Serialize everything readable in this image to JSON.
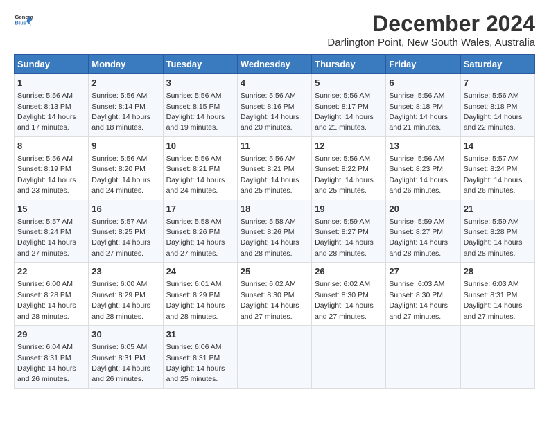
{
  "logo": {
    "line1": "General",
    "line2": "Blue"
  },
  "title": "December 2024",
  "subtitle": "Darlington Point, New South Wales, Australia",
  "days_of_week": [
    "Sunday",
    "Monday",
    "Tuesday",
    "Wednesday",
    "Thursday",
    "Friday",
    "Saturday"
  ],
  "weeks": [
    [
      {
        "day": "1",
        "sunrise": "Sunrise: 5:56 AM",
        "sunset": "Sunset: 8:13 PM",
        "daylight": "Daylight: 14 hours and 17 minutes."
      },
      {
        "day": "2",
        "sunrise": "Sunrise: 5:56 AM",
        "sunset": "Sunset: 8:14 PM",
        "daylight": "Daylight: 14 hours and 18 minutes."
      },
      {
        "day": "3",
        "sunrise": "Sunrise: 5:56 AM",
        "sunset": "Sunset: 8:15 PM",
        "daylight": "Daylight: 14 hours and 19 minutes."
      },
      {
        "day": "4",
        "sunrise": "Sunrise: 5:56 AM",
        "sunset": "Sunset: 8:16 PM",
        "daylight": "Daylight: 14 hours and 20 minutes."
      },
      {
        "day": "5",
        "sunrise": "Sunrise: 5:56 AM",
        "sunset": "Sunset: 8:17 PM",
        "daylight": "Daylight: 14 hours and 21 minutes."
      },
      {
        "day": "6",
        "sunrise": "Sunrise: 5:56 AM",
        "sunset": "Sunset: 8:18 PM",
        "daylight": "Daylight: 14 hours and 21 minutes."
      },
      {
        "day": "7",
        "sunrise": "Sunrise: 5:56 AM",
        "sunset": "Sunset: 8:18 PM",
        "daylight": "Daylight: 14 hours and 22 minutes."
      }
    ],
    [
      {
        "day": "8",
        "sunrise": "Sunrise: 5:56 AM",
        "sunset": "Sunset: 8:19 PM",
        "daylight": "Daylight: 14 hours and 23 minutes."
      },
      {
        "day": "9",
        "sunrise": "Sunrise: 5:56 AM",
        "sunset": "Sunset: 8:20 PM",
        "daylight": "Daylight: 14 hours and 24 minutes."
      },
      {
        "day": "10",
        "sunrise": "Sunrise: 5:56 AM",
        "sunset": "Sunset: 8:21 PM",
        "daylight": "Daylight: 14 hours and 24 minutes."
      },
      {
        "day": "11",
        "sunrise": "Sunrise: 5:56 AM",
        "sunset": "Sunset: 8:21 PM",
        "daylight": "Daylight: 14 hours and 25 minutes."
      },
      {
        "day": "12",
        "sunrise": "Sunrise: 5:56 AM",
        "sunset": "Sunset: 8:22 PM",
        "daylight": "Daylight: 14 hours and 25 minutes."
      },
      {
        "day": "13",
        "sunrise": "Sunrise: 5:56 AM",
        "sunset": "Sunset: 8:23 PM",
        "daylight": "Daylight: 14 hours and 26 minutes."
      },
      {
        "day": "14",
        "sunrise": "Sunrise: 5:57 AM",
        "sunset": "Sunset: 8:24 PM",
        "daylight": "Daylight: 14 hours and 26 minutes."
      }
    ],
    [
      {
        "day": "15",
        "sunrise": "Sunrise: 5:57 AM",
        "sunset": "Sunset: 8:24 PM",
        "daylight": "Daylight: 14 hours and 27 minutes."
      },
      {
        "day": "16",
        "sunrise": "Sunrise: 5:57 AM",
        "sunset": "Sunset: 8:25 PM",
        "daylight": "Daylight: 14 hours and 27 minutes."
      },
      {
        "day": "17",
        "sunrise": "Sunrise: 5:58 AM",
        "sunset": "Sunset: 8:26 PM",
        "daylight": "Daylight: 14 hours and 27 minutes."
      },
      {
        "day": "18",
        "sunrise": "Sunrise: 5:58 AM",
        "sunset": "Sunset: 8:26 PM",
        "daylight": "Daylight: 14 hours and 28 minutes."
      },
      {
        "day": "19",
        "sunrise": "Sunrise: 5:59 AM",
        "sunset": "Sunset: 8:27 PM",
        "daylight": "Daylight: 14 hours and 28 minutes."
      },
      {
        "day": "20",
        "sunrise": "Sunrise: 5:59 AM",
        "sunset": "Sunset: 8:27 PM",
        "daylight": "Daylight: 14 hours and 28 minutes."
      },
      {
        "day": "21",
        "sunrise": "Sunrise: 5:59 AM",
        "sunset": "Sunset: 8:28 PM",
        "daylight": "Daylight: 14 hours and 28 minutes."
      }
    ],
    [
      {
        "day": "22",
        "sunrise": "Sunrise: 6:00 AM",
        "sunset": "Sunset: 8:28 PM",
        "daylight": "Daylight: 14 hours and 28 minutes."
      },
      {
        "day": "23",
        "sunrise": "Sunrise: 6:00 AM",
        "sunset": "Sunset: 8:29 PM",
        "daylight": "Daylight: 14 hours and 28 minutes."
      },
      {
        "day": "24",
        "sunrise": "Sunrise: 6:01 AM",
        "sunset": "Sunset: 8:29 PM",
        "daylight": "Daylight: 14 hours and 28 minutes."
      },
      {
        "day": "25",
        "sunrise": "Sunrise: 6:02 AM",
        "sunset": "Sunset: 8:30 PM",
        "daylight": "Daylight: 14 hours and 27 minutes."
      },
      {
        "day": "26",
        "sunrise": "Sunrise: 6:02 AM",
        "sunset": "Sunset: 8:30 PM",
        "daylight": "Daylight: 14 hours and 27 minutes."
      },
      {
        "day": "27",
        "sunrise": "Sunrise: 6:03 AM",
        "sunset": "Sunset: 8:30 PM",
        "daylight": "Daylight: 14 hours and 27 minutes."
      },
      {
        "day": "28",
        "sunrise": "Sunrise: 6:03 AM",
        "sunset": "Sunset: 8:31 PM",
        "daylight": "Daylight: 14 hours and 27 minutes."
      }
    ],
    [
      {
        "day": "29",
        "sunrise": "Sunrise: 6:04 AM",
        "sunset": "Sunset: 8:31 PM",
        "daylight": "Daylight: 14 hours and 26 minutes."
      },
      {
        "day": "30",
        "sunrise": "Sunrise: 6:05 AM",
        "sunset": "Sunset: 8:31 PM",
        "daylight": "Daylight: 14 hours and 26 minutes."
      },
      {
        "day": "31",
        "sunrise": "Sunrise: 6:06 AM",
        "sunset": "Sunset: 8:31 PM",
        "daylight": "Daylight: 14 hours and 25 minutes."
      },
      {
        "day": "",
        "sunrise": "",
        "sunset": "",
        "daylight": ""
      },
      {
        "day": "",
        "sunrise": "",
        "sunset": "",
        "daylight": ""
      },
      {
        "day": "",
        "sunrise": "",
        "sunset": "",
        "daylight": ""
      },
      {
        "day": "",
        "sunrise": "",
        "sunset": "",
        "daylight": ""
      }
    ]
  ]
}
